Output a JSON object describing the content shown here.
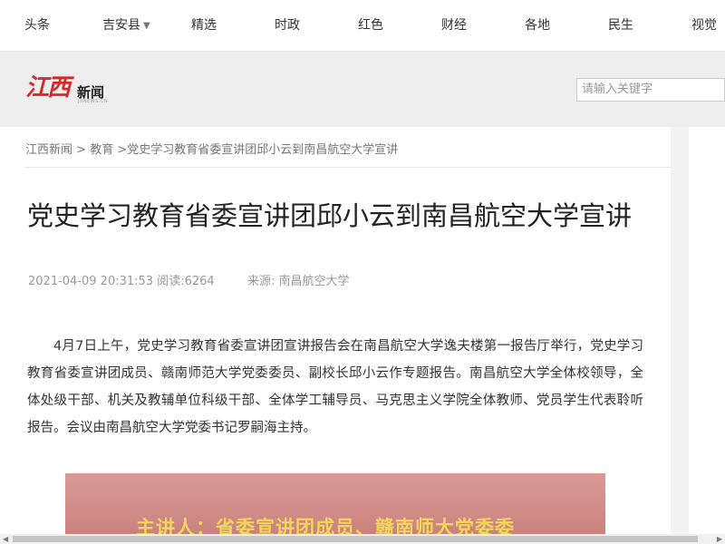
{
  "nav": {
    "items": [
      {
        "label": "头条"
      },
      {
        "label": "吉安县",
        "has_dropdown": true
      },
      {
        "label": "精选"
      },
      {
        "label": "时政"
      },
      {
        "label": "红色"
      },
      {
        "label": "财经"
      },
      {
        "label": "各地"
      },
      {
        "label": "民生"
      },
      {
        "label": "视觉"
      }
    ],
    "dropdown_icon": "caret-down-icon"
  },
  "logo": {
    "mark": "江西",
    "word": "新闻",
    "sub": "JXNEWS.CN"
  },
  "search": {
    "placeholder": "请输入关键字"
  },
  "breadcrumb": {
    "home": "江西新闻",
    "sep": ">",
    "section": "教育",
    "current": "党史学习教育省委宣讲团邱小云到南昌航空大学宣讲"
  },
  "article": {
    "title": "党史学习教育省委宣讲团邱小云到南昌航空大学宣讲",
    "datetime": "2021-04-09 20:31:53",
    "reads_label": "阅读:",
    "reads_count": "6264",
    "source_label": "来源:",
    "source": "南昌航空大学",
    "body": "4月7日上午，党史学习教育省委宣讲团宣讲报告会在南昌航空大学逸夫楼第一报告厅举行，党史学习教育省委宣讲团成员、赣南师范大学党委委员、副校长邱小云作专题报告。南昌航空大学全体校领导，全体处级干部、机关及教辅单位科级干部、全体学工辅导员、马克思主义学院全体教师、党员学生代表聆听报告。会议由南昌航空大学党委书记罗嗣海主持。",
    "photo_caption": "主讲人：省委宣讲团成员、赣南师大党委委"
  },
  "colors": {
    "brand_red": "#d62a2a",
    "caption_yellow": "#f2d65a"
  }
}
